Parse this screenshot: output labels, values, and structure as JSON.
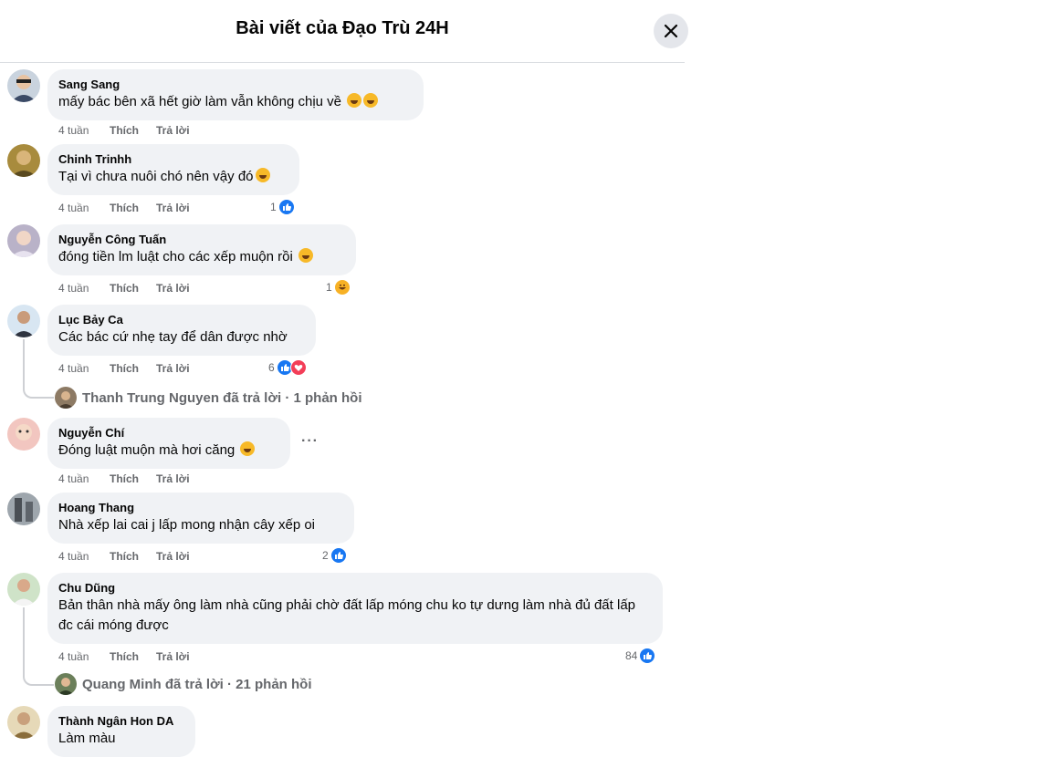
{
  "header": {
    "title": "Bài viết của Đạo Trù 24H",
    "close_icon": "close-icon"
  },
  "comments": [
    {
      "author": "Sang Sang",
      "text": "mấy bác bên xã hết giờ làm vẫn không chịu về",
      "time": "4 tuần",
      "like": "Thích",
      "reply": "Trả lời",
      "emojis": [
        "rofl-emoji",
        "grin-sweat-emoji"
      ]
    },
    {
      "author": "Chinh Trinhh",
      "text": "Tại vì chưa nuôi chó nên vậy đó",
      "time": "4 tuần",
      "like": "Thích",
      "reply": "Trả lời",
      "reaction_count": "1",
      "emojis": [
        "grin-sweat-emoji"
      ]
    },
    {
      "author": "Nguyễn Công Tuấn",
      "text": "đóng tiền lm luật cho các xếp muộn rồi",
      "time": "4 tuần",
      "like": "Thích",
      "reply": "Trả lời",
      "reaction_count": "1",
      "emojis": [
        "grin-sweat-emoji"
      ]
    },
    {
      "author": "Lục Bảy Ca",
      "text": "Các bác cứ nhẹ tay để dân được nhờ",
      "time": "4 tuần",
      "like": "Thích",
      "reply": "Trả lời",
      "reaction_count": "6",
      "reply_summary": "Thanh Trung Nguyen đã trả lời · 1 phản hồi"
    },
    {
      "author": "Nguyễn Chí",
      "text": "Đóng luật muộn mà hơi căng",
      "time": "4 tuần",
      "like": "Thích",
      "reply": "Trả lời",
      "more": "···",
      "emojis": [
        "rofl-emoji"
      ]
    },
    {
      "author": "Hoang Thang",
      "text": "Nhà xếp lai cai j lấp mong nhận cây xếp oi",
      "time": "4 tuần",
      "like": "Thích",
      "reply": "Trả lời",
      "reaction_count": "2"
    },
    {
      "author": "Chu Dũng",
      "text": "Bản thân nhà mấy ông làm nhà cũng phải chờ đất lấp móng chu ko tự dưng làm nhà đủ đất lấp đc cái móng được",
      "time": "4 tuần",
      "like": "Thích",
      "reply": "Trả lời",
      "reaction_count": "84",
      "reply_summary": "Quang Minh đã trả lời · 21 phản hồi"
    },
    {
      "author": "Thành Ngân Hon DA",
      "text": "Làm màu"
    }
  ],
  "colors": {
    "bubble": "#f0f2f5",
    "meta": "#65676b",
    "like_blue": "#1877f2",
    "love_red": "#f33e58",
    "haha_yellow": "#f7b125"
  }
}
